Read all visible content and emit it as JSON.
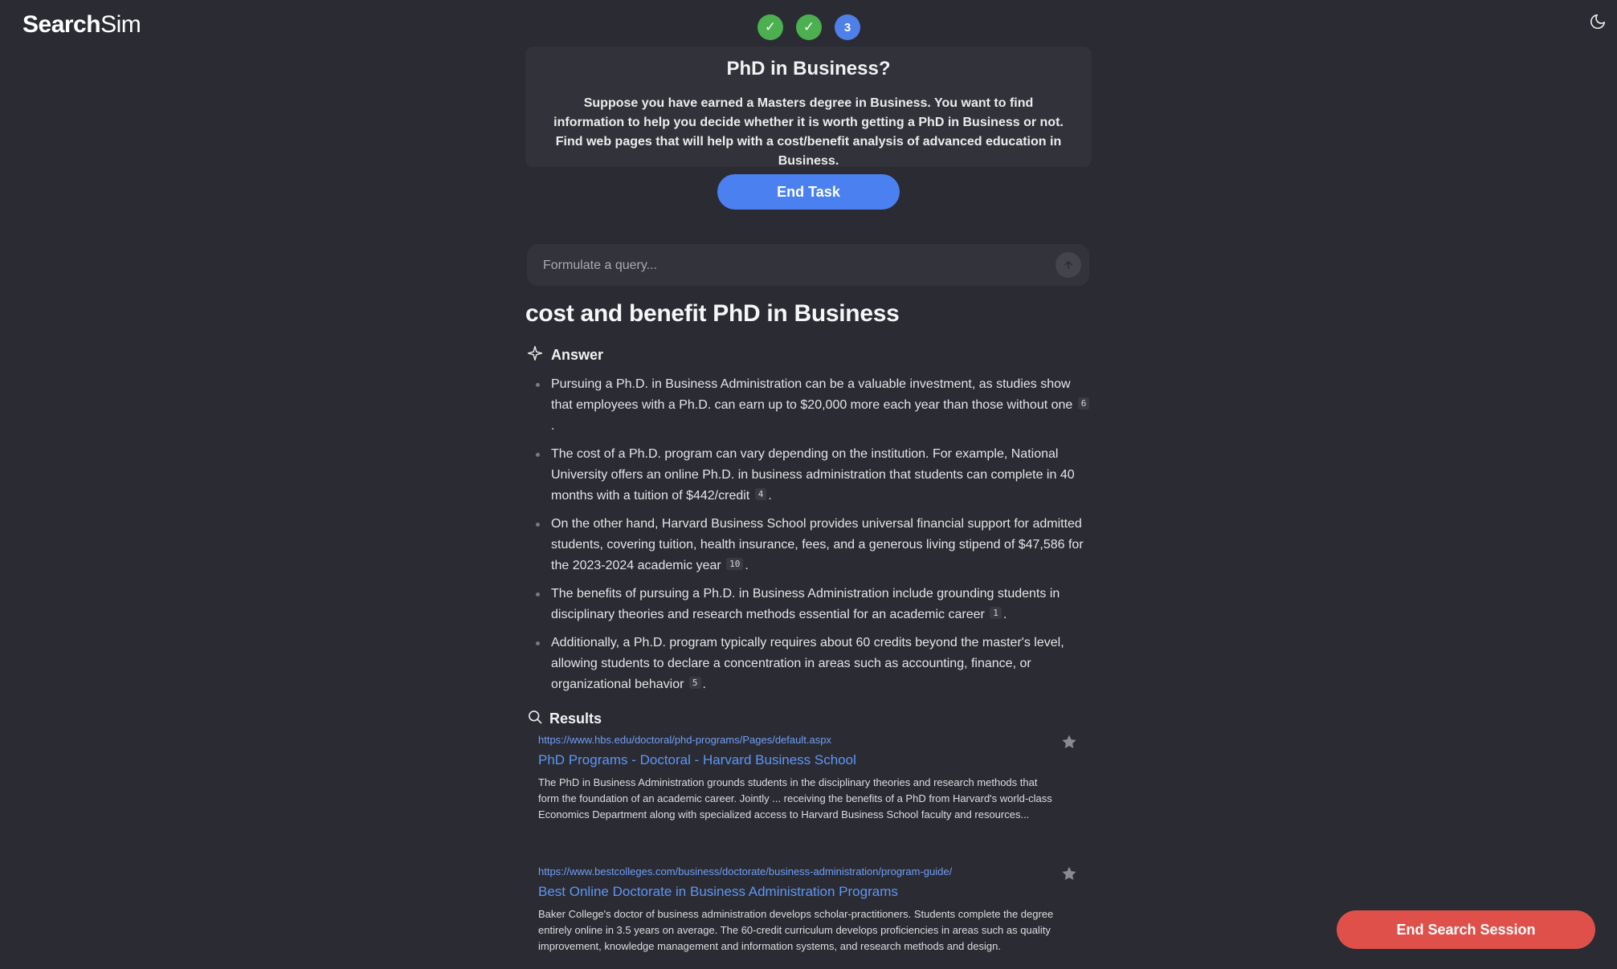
{
  "app": {
    "logo_bold": "Search",
    "logo_light": "Sim"
  },
  "progress": {
    "steps": [
      {
        "label": "✓",
        "state": "done"
      },
      {
        "label": "✓",
        "state": "done"
      },
      {
        "label": "3",
        "state": "current"
      }
    ]
  },
  "task": {
    "title": "PhD in Business?",
    "description": "Suppose you have earned a Masters degree in Business. You want to find information to help you decide whether it is worth getting a PhD in Business or not. Find web pages that will help with a cost/benefit analysis of advanced education in Business.",
    "end_task_label": "End Task"
  },
  "search": {
    "placeholder": "Formulate a query...",
    "query_heading": "cost and benefit PhD in Business"
  },
  "answer": {
    "heading": "Answer",
    "items": [
      {
        "text": "Pursuing a Ph.D. in Business Administration can be a valuable investment, as studies show that employees with a Ph.D. can earn up to $20,000 more each year than those without one",
        "cite": "6"
      },
      {
        "text": "The cost of a Ph.D. program can vary depending on the institution. For example, National University offers an online Ph.D. in business administration that students can complete in 40 months with a tuition of $442/credit",
        "cite": "4"
      },
      {
        "text": "On the other hand, Harvard Business School provides universal financial support for admitted students, covering tuition, health insurance, fees, and a generous living stipend of $47,586 for the 2023-2024 academic year",
        "cite": "10"
      },
      {
        "text": "The benefits of pursuing a Ph.D. in Business Administration include grounding students in disciplinary theories and research methods essential for an academic career",
        "cite": "1"
      },
      {
        "text": "Additionally, a Ph.D. program typically requires about 60 credits beyond the master's level, allowing students to declare a concentration in areas such as accounting, finance, or organizational behavior",
        "cite": "5"
      }
    ]
  },
  "results": {
    "heading": "Results",
    "items": [
      {
        "url": "https://www.hbs.edu/doctoral/phd-programs/Pages/default.aspx",
        "title": "PhD Programs - Doctoral - Harvard Business School",
        "snippet": "The PhD in Business Administration grounds students in the disciplinary theories and research methods that form the foundation of an academic career. Jointly ... receiving the benefits of a PhD from Harvard's world-class Economics Department along with specialized access to Harvard Business School faculty and resources..."
      },
      {
        "url": "https://www.bestcolleges.com/business/doctorate/business-administration/program-guide/",
        "title": "Best Online Doctorate in Business Administration Programs",
        "snippet": "Baker College's doctor of business administration develops scholar-practitioners. Students complete the degree entirely online in 3.5 years on average. The 60-credit curriculum develops proficiencies in areas such as quality improvement, knowledge management and information systems, and research methods and design."
      }
    ]
  },
  "footer": {
    "end_session_label": "End Search Session"
  },
  "colors": {
    "background": "#2b2c33",
    "primary_button": "#4a80f0",
    "danger_button": "#e0504a",
    "step_done": "#4caf50",
    "step_current": "#4f7fe8",
    "link": "#5f95f4"
  },
  "icons": {
    "theme_toggle": "moon-icon",
    "answer": "sparkle-icon",
    "results": "search-icon",
    "send": "arrow-up-icon",
    "bookmark": "star-icon"
  }
}
